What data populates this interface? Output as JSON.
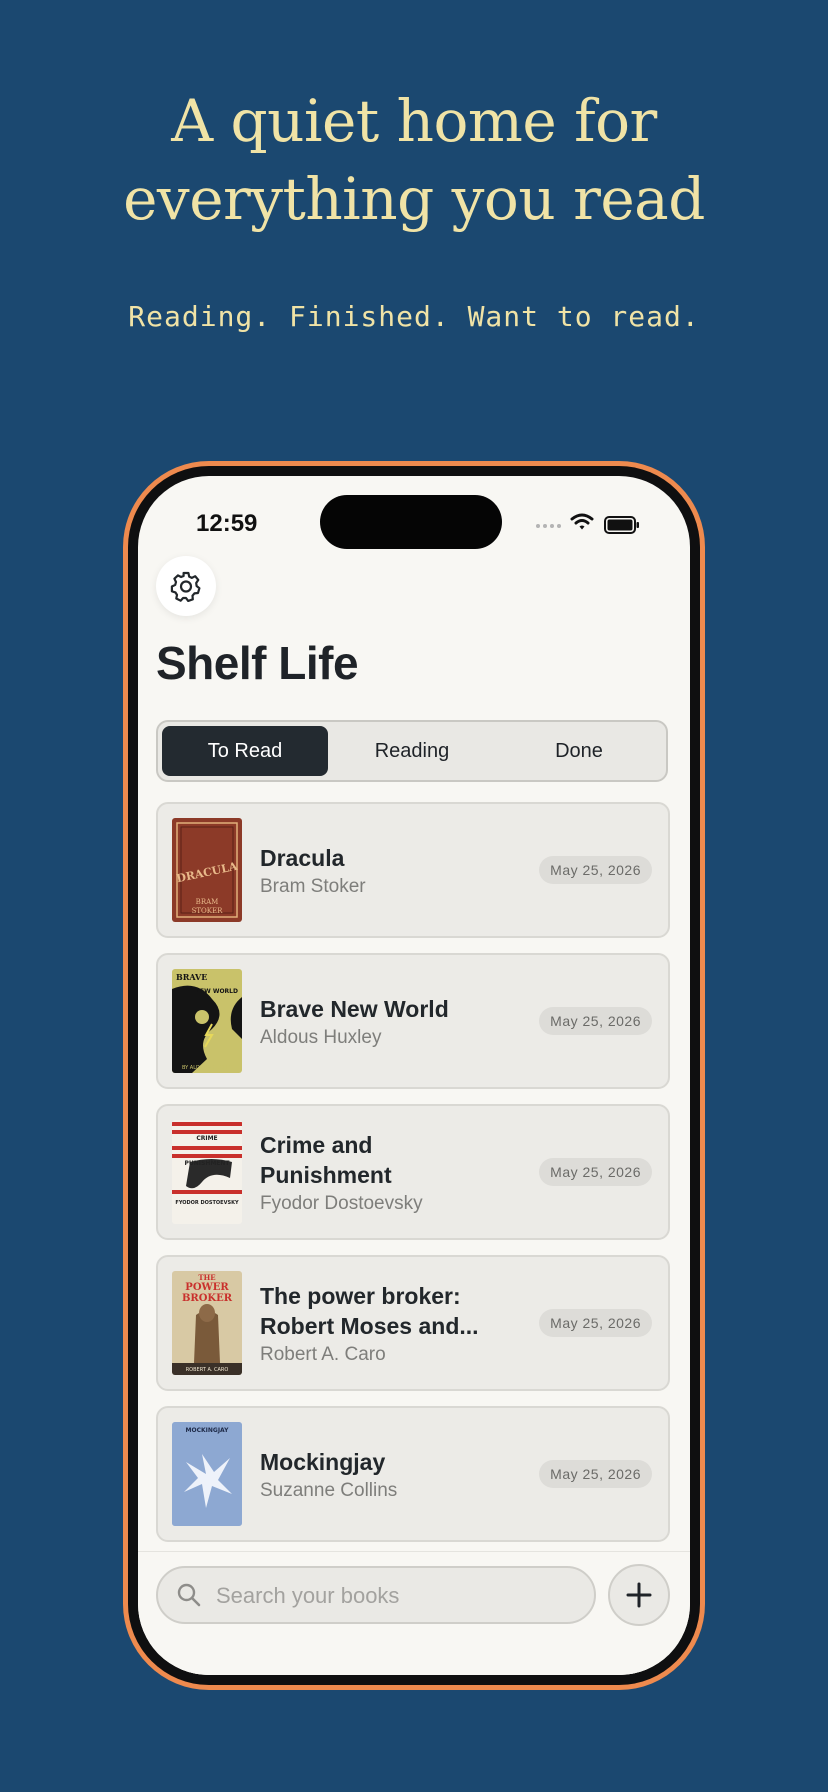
{
  "promo": {
    "headline_line1": "A quiet home for",
    "headline_line2": "everything you read",
    "subline": "Reading. Finished. Want to read."
  },
  "status_bar": {
    "time": "12:59"
  },
  "header": {
    "settings_icon": "gear-icon",
    "title": "Shelf Life"
  },
  "tabs": [
    {
      "label": "To Read",
      "active": true
    },
    {
      "label": "Reading",
      "active": false
    },
    {
      "label": "Done",
      "active": false
    }
  ],
  "books": [
    {
      "title": "Dracula",
      "author": "Bram Stoker",
      "date": "May 25, 2026",
      "cover_color": "#8c3a28"
    },
    {
      "title": "Brave New World",
      "author": "Aldous Huxley",
      "date": "May 25, 2026",
      "cover_color": "#c9c26a"
    },
    {
      "title": "Crime and Punishment",
      "author": "Fyodor Dostoevsky",
      "date": "May 25, 2026",
      "cover_color": "#c9302c"
    },
    {
      "title": "The power broker: Robert Moses and...",
      "author": "Robert A. Caro",
      "date": "May 25, 2026",
      "cover_color": "#d8c9a4"
    },
    {
      "title": "Mockingjay",
      "author": "Suzanne Collins",
      "date": "May 25, 2026",
      "cover_color": "#6f8fc4"
    }
  ],
  "covers": {
    "dracula_text_1": "DRACULA",
    "dracula_text_2": "BRAM",
    "dracula_text_3": "STOKER",
    "brave_text_1": "BRAVE",
    "brave_text_2": "NEW WORLD",
    "brave_text_3": "BY ALDOUS HUXLEY",
    "crime_text_1": "CRIME",
    "crime_text_2": "PUNISHMENT",
    "crime_text_3": "FYODOR DOSTOEVSKY",
    "broker_text_1": "THE",
    "broker_text_2": "POWER",
    "broker_text_3": "BROKER",
    "broker_text_4": "ROBERT A. CARO",
    "mockingjay_text_1": "MOCKINGJAY"
  },
  "search": {
    "placeholder": "Search your books"
  },
  "add_button": {
    "icon": "plus-icon"
  }
}
